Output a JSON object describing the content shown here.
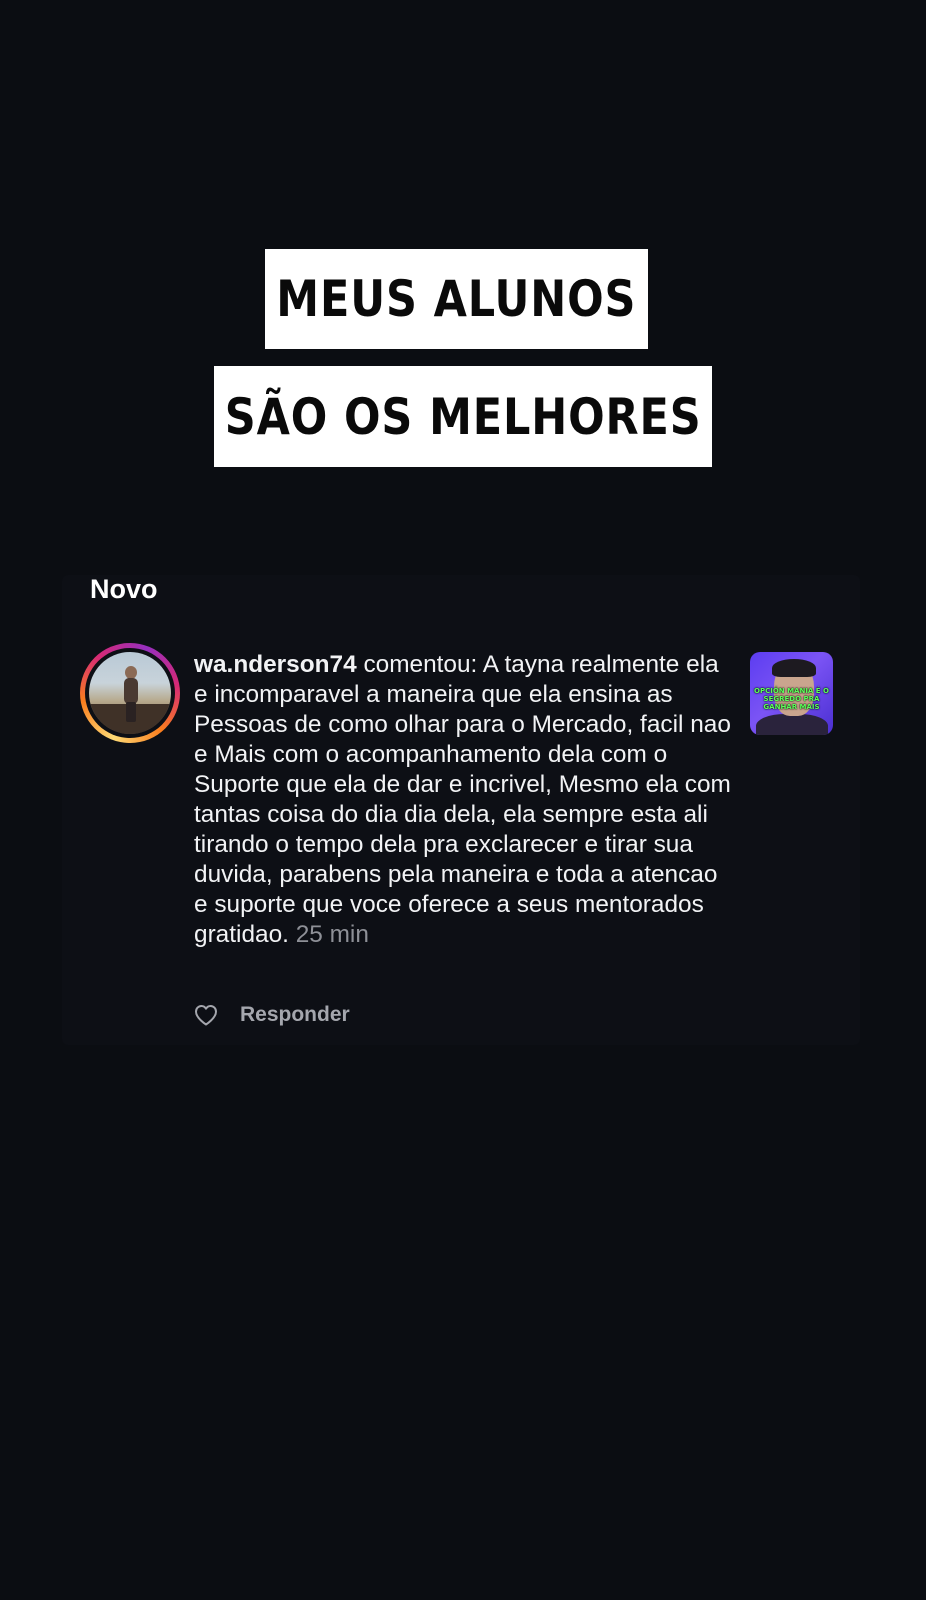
{
  "headline": {
    "line1": "MEUS ALUNOS",
    "line2": "SÃO OS MELHORES"
  },
  "notification": {
    "section_title": "Novo",
    "username": "wa.nderson74",
    "comment_text": " comentou: A tayna realmente ela e incomparavel a maneira que ela ensina as Pessoas de como olhar para o Mercado, facil nao e Mais com o acompanhamento dela com o Suporte que ela de dar e incrivel, Mesmo ela com tantas coisa do dia dia dela, ela sempre esta ali tirando o tempo dela pra exclarecer e tirar sua duvida, parabens pela maneira e toda a atencao e suporte que voce oferece a seus mentorados gratidao.",
    "time": " 25 min",
    "thumbnail_caption": "OPCIÓN MANIA É O SEGREDO PRA GANHAR MAIS",
    "reply_label": "Responder",
    "icons": {
      "like": "heart-icon",
      "avatar": "avatar",
      "thumbnail": "post-thumbnail"
    }
  },
  "colors": {
    "background": "#0b0d12",
    "card": "#0d0f15",
    "headline_box": "#ffffff",
    "text_primary": "#f2f3f5",
    "text_secondary": "#8e9097",
    "thumbnail_bg": "#6a4af2",
    "thumbnail_caption": "#5dff5a"
  }
}
